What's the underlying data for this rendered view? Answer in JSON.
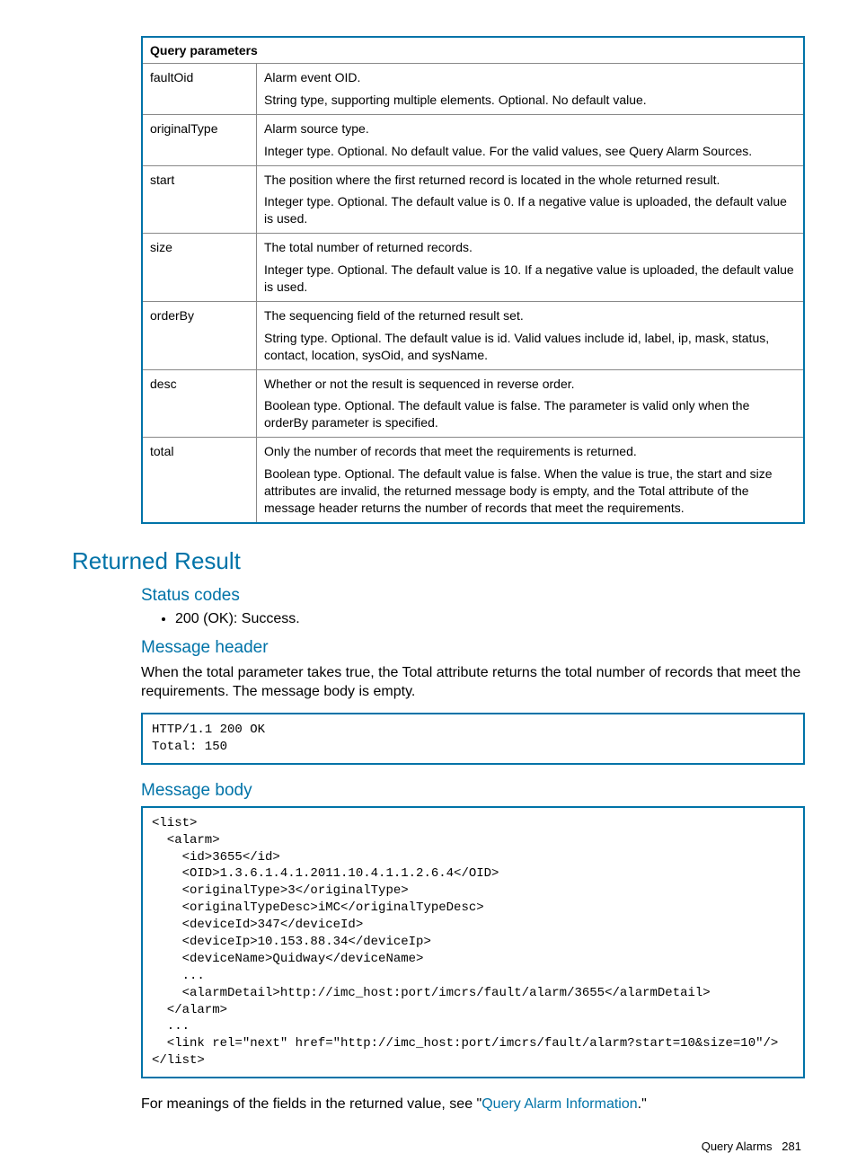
{
  "table": {
    "header": "Query parameters",
    "rows": [
      {
        "name": "faultOid",
        "desc1": "Alarm event OID.",
        "desc2": "String type, supporting multiple elements. Optional. No default value."
      },
      {
        "name": "originalType",
        "desc1": "Alarm source type.",
        "desc2": "Integer type. Optional. No default value. For the valid values, see Query Alarm Sources."
      },
      {
        "name": "start",
        "desc1": "The position where the first returned record is located in the whole returned result.",
        "desc2": "Integer type. Optional. The default value is 0. If a negative value is uploaded, the default value is used."
      },
      {
        "name": "size",
        "desc1": "The total number of returned records.",
        "desc2": "Integer type. Optional. The default value is 10. If a negative value is uploaded, the default value is used."
      },
      {
        "name": "orderBy",
        "desc1": "The sequencing field of the returned result set.",
        "desc2": "String type. Optional. The default value is id. Valid values include id, label, ip, mask, status, contact, location, sysOid, and sysName."
      },
      {
        "name": "desc",
        "desc1": "Whether or not the result is sequenced in reverse order.",
        "desc2": "Boolean type. Optional. The default value is false. The parameter is valid only when the orderBy parameter is specified."
      },
      {
        "name": "total",
        "desc1": "Only the number of records that meet the requirements is returned.",
        "desc2": "Boolean type. Optional. The default value is false. When the value is true, the start and size attributes are invalid, the returned message body is empty, and the Total attribute of the message header returns the number of records that meet the requirements."
      }
    ]
  },
  "sections": {
    "returned_result": "Returned Result",
    "status_codes": "Status codes",
    "status_bullet": "200 (OK): Success.",
    "message_header": "Message header",
    "message_header_body": "When the total parameter takes true, the Total attribute returns the total number of records that meet the requirements. The message body is empty.",
    "code_header": "HTTP/1.1 200 OK\nTotal: 150",
    "message_body": "Message body",
    "code_body": "<list>\n  <alarm>\n    <id>3655</id>\n    <OID>1.3.6.1.4.1.2011.10.4.1.1.2.6.4</OID>\n    <originalType>3</originalType>\n    <originalTypeDesc>iMC</originalTypeDesc>\n    <deviceId>347</deviceId>\n    <deviceIp>10.153.88.34</deviceIp>\n    <deviceName>Quidway</deviceName>\n    ...\n    <alarmDetail>http://imc_host:port/imcrs/fault/alarm/3655</alarmDetail>\n  </alarm>\n  ...\n  <link rel=\"next\" href=\"http://imc_host:port/imcrs/fault/alarm?start=10&size=10\"/>\n</list>",
    "footer_prefix": "For meanings of the fields in the returned value, see \"",
    "footer_link": "Query Alarm Information",
    "footer_suffix": ".\""
  },
  "page_footer": {
    "label": "Query Alarms",
    "pagenum": "281"
  }
}
